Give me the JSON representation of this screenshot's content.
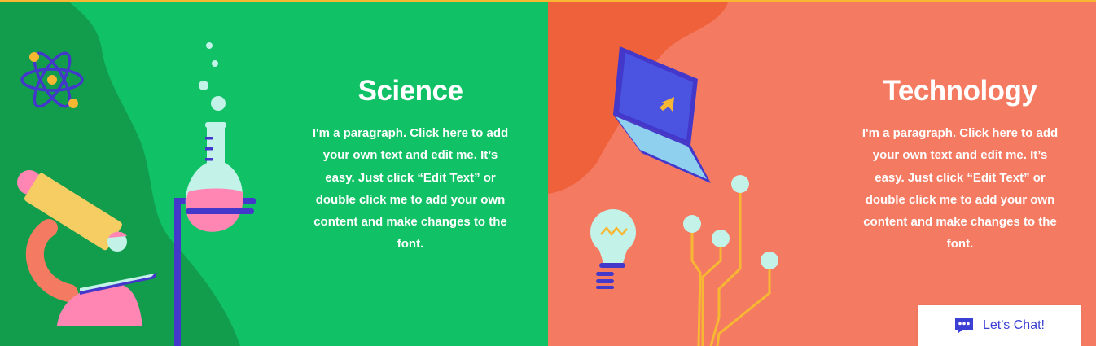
{
  "sections": [
    {
      "title": "Science",
      "paragraph": "I'm a paragraph. Click here to add your own text and edit me. It’s easy. Just click “Edit Text” or double click me to add your own content and make changes to the font.",
      "colors": {
        "background": "#10c265",
        "shape": "#129d4c"
      }
    },
    {
      "title": "Technology",
      "paragraph": "I'm a paragraph. Click here to add your own text and edit me. It’s easy. Just click “Edit Text” or double click me to add your own content and make changes to the font.",
      "colors": {
        "background": "#f47b62",
        "shape": "#ee613b"
      }
    }
  ],
  "chat_widget": {
    "label": "Let's Chat!",
    "icon": "chat-bubble-icon",
    "color": "#3b3fd4"
  },
  "accent_colors": {
    "topline": "#f7b733",
    "yellow": "#f7b733",
    "pink": "#ff85b3",
    "blue": "#4338ca",
    "mint": "#c3f2e9"
  },
  "icons": [
    "atom-icon",
    "microscope-icon",
    "flask-icon",
    "bubble-icon",
    "laptop-icon",
    "lightbulb-icon",
    "circuit-icon"
  ]
}
